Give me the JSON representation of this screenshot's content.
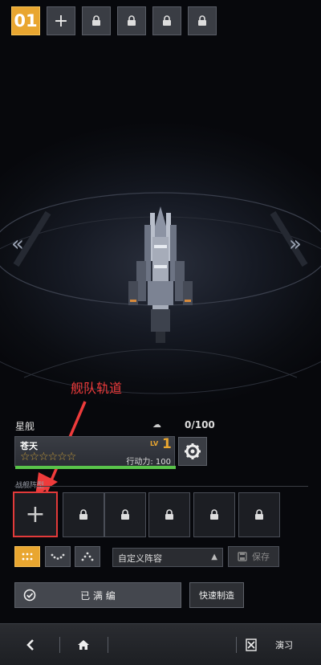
{
  "fleet_tabs": [
    {
      "label": "01",
      "state": "active"
    },
    {
      "label": "+",
      "state": "add"
    },
    {
      "label": "",
      "state": "locked",
      "icon": "lock-icon"
    },
    {
      "label": "",
      "state": "locked",
      "icon": "lock-icon"
    },
    {
      "label": "",
      "state": "locked",
      "icon": "lock-icon"
    },
    {
      "label": "",
      "state": "locked",
      "icon": "lock-icon"
    }
  ],
  "nav": {
    "prev": "«",
    "next": "»"
  },
  "annotation": {
    "text": "舰队轨道",
    "color": "#ee3b3b"
  },
  "ship_section": {
    "label": "星舰",
    "count": "0/100",
    "ship": {
      "name": "苍天",
      "stars": "☆☆☆☆☆☆",
      "level_label": "LV",
      "level": "1",
      "power": "行动力: 100",
      "hp_fraction": 1.0
    }
  },
  "track_label": "战舰阵型",
  "slots": {
    "add_symbol": "+",
    "locked_count": 5
  },
  "formation": {
    "modes": [
      {
        "name": "formation-grid-icon",
        "active": true
      },
      {
        "name": "formation-arc-icon",
        "active": false
      },
      {
        "name": "formation-wedge-icon",
        "active": false
      }
    ],
    "select_value": "自定义阵容",
    "save_label": "保存"
  },
  "actions": {
    "edited_label": "已 满 编",
    "quick_label": "快速制造"
  },
  "bottom_bar": {
    "back_icon": "back-icon",
    "home_icon": "home-icon",
    "drill_label": "演习"
  },
  "colors": {
    "accent": "#e9a630",
    "annotation": "#ee3b3b",
    "hp": "#59c44a"
  }
}
